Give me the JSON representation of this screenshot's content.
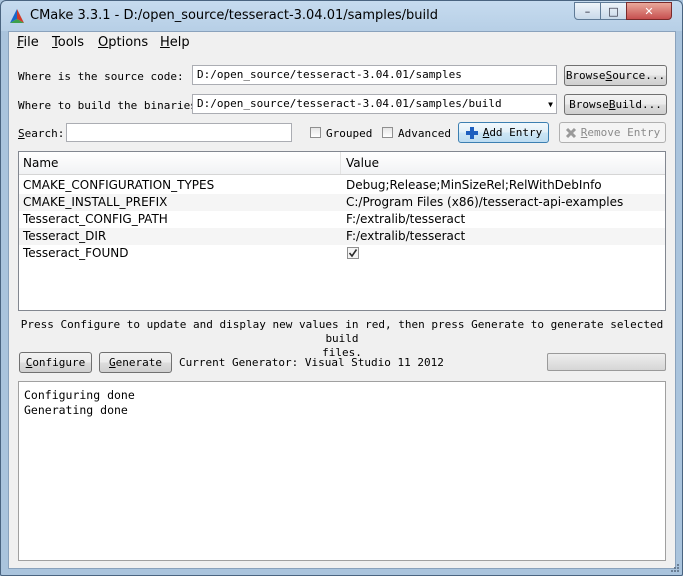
{
  "window": {
    "title": "CMake 3.3.1 - D:/open_source/tesseract-3.04.01/samples/build",
    "minimize_symbol": "–",
    "maximize_symbol": "□",
    "close_symbol": "✕"
  },
  "menu": {
    "items": [
      {
        "label": "File",
        "mnemonic": "F",
        "rest": "ile"
      },
      {
        "label": "Tools",
        "mnemonic": "T",
        "rest": "ools"
      },
      {
        "label": "Options",
        "mnemonic": "O",
        "rest": "ptions"
      },
      {
        "label": "Help",
        "mnemonic": "H",
        "rest": "elp"
      }
    ]
  },
  "source": {
    "label": "Where is the source code:",
    "value": "D:/open_source/tesseract-3.04.01/samples",
    "browse_pre": "Browse ",
    "browse_mn": "S",
    "browse_post": "ource..."
  },
  "build": {
    "label": "Where to build the binaries:",
    "value": "D:/open_source/tesseract-3.04.01/samples/build",
    "browse_pre": "Browse ",
    "browse_mn": "B",
    "browse_post": "uild..."
  },
  "search": {
    "label_mn": "S",
    "label_rest": "earch:",
    "value": "",
    "grouped_label": "Grouped",
    "advanced_label": "Advanced",
    "add_entry_mn": "A",
    "add_entry_rest": "dd Entry",
    "remove_entry_mn": "R",
    "remove_entry_rest": "emove Entry"
  },
  "table": {
    "columns": [
      "Name",
      "Value"
    ],
    "rows": [
      {
        "name": "CMAKE_CONFIGURATION_TYPES",
        "value": "Debug;Release;MinSizeRel;RelWithDebInfo"
      },
      {
        "name": "CMAKE_INSTALL_PREFIX",
        "value": "C:/Program Files (x86)/tesseract-api-examples"
      },
      {
        "name": "Tesseract_CONFIG_PATH",
        "value": "F:/extralib/tesseract"
      },
      {
        "name": "Tesseract_DIR",
        "value": "F:/extralib/tesseract"
      },
      {
        "name": "Tesseract_FOUND",
        "value": "",
        "checked": true
      }
    ]
  },
  "hint": {
    "line1": "Press Configure to update and display new values in red, then press Generate to generate selected build",
    "line2": "files."
  },
  "actions": {
    "configure_mn": "C",
    "configure_rest": "onfigure",
    "generate_mn": "G",
    "generate_rest": "enerate",
    "generator_text": "Current Generator: Visual Studio 11 2012",
    "progress": 0
  },
  "output": {
    "lines": [
      "Configuring done",
      "Generating done"
    ]
  },
  "colors": {
    "frame": "#aac4dd",
    "close_button": "#c75050",
    "add_icon": "#1d5fbf",
    "remove_icon": "#9a9a9a"
  }
}
